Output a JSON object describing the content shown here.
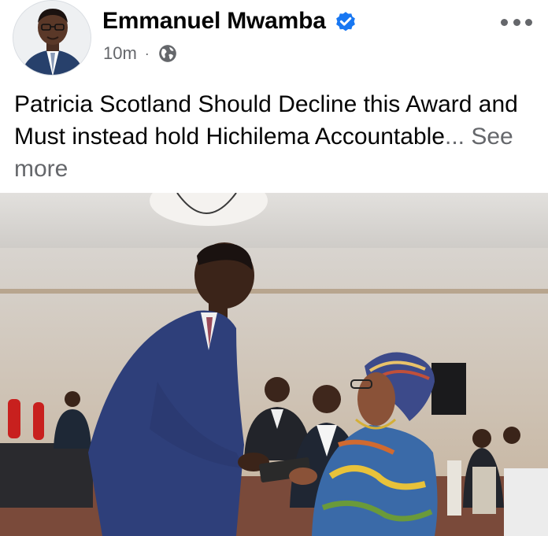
{
  "post": {
    "author": "Emmanuel Mwamba",
    "timestamp": "10m",
    "separator": "·",
    "text": "Patricia Scotland Should Decline this Award and Must instead hold Hichilema Accountable",
    "ellipsis": "...",
    "see_more": "See more"
  },
  "icons": {
    "verified": "verified-badge-icon",
    "audience": "globe-icon",
    "more": "more-options-icon"
  },
  "colors": {
    "verified_blue": "#1877f2",
    "secondary_text": "#65676b",
    "primary_text": "#050505"
  }
}
